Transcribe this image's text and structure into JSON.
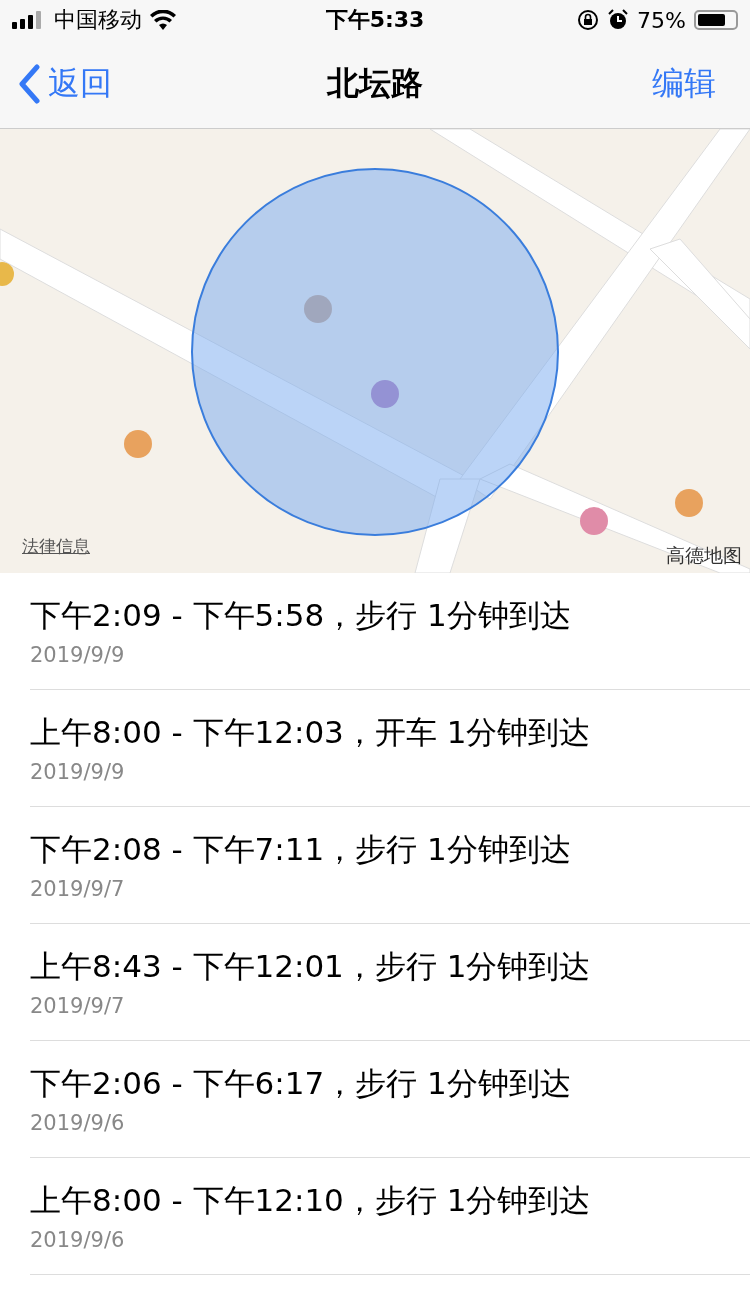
{
  "status_bar": {
    "carrier": "中国移动",
    "time": "下午5:33",
    "battery": "75%"
  },
  "nav": {
    "back": "返回",
    "title": "北坛路",
    "action": "编辑"
  },
  "map": {
    "kind": "picture",
    "legal_link": "法律信息",
    "provider": "高德地图"
  },
  "visits": [
    {
      "title": "下午2:09 - 下午5:58，步行 1分钟到达",
      "date": "2019/9/9"
    },
    {
      "title": "上午8:00 - 下午12:03，开车 1分钟到达",
      "date": "2019/9/9"
    },
    {
      "title": "下午2:08 - 下午7:11，步行 1分钟到达",
      "date": "2019/9/7"
    },
    {
      "title": "上午8:43 - 下午12:01，步行 1分钟到达",
      "date": "2019/9/7"
    },
    {
      "title": "下午2:06 - 下午6:17，步行 1分钟到达",
      "date": "2019/9/6"
    },
    {
      "title": "上午8:00 - 下午12:10，步行 1分钟到达",
      "date": "2019/9/6"
    }
  ]
}
